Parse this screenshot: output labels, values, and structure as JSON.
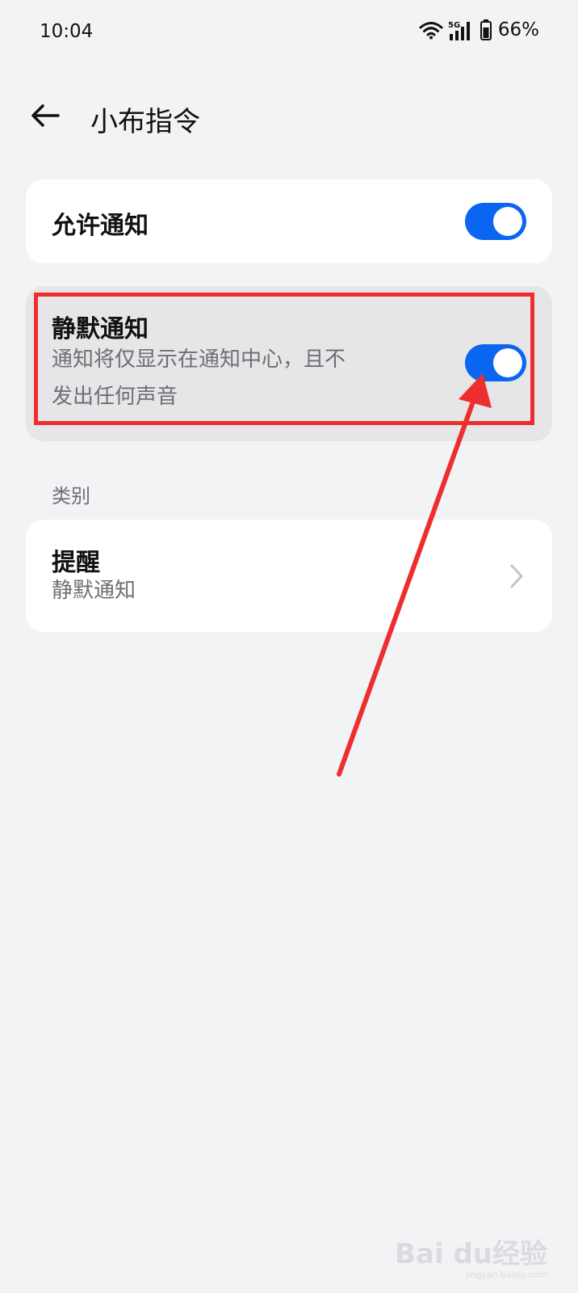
{
  "status": {
    "time": "10:04",
    "network": "5G",
    "battery": "66%"
  },
  "header": {
    "title": "小布指令"
  },
  "allow_notification": {
    "label": "允许通知",
    "enabled": true
  },
  "silent_notification": {
    "label": "静默通知",
    "desc_line1": "通知将仅显示在通知中心，且不",
    "desc_line2": "发出任何声音",
    "enabled": true
  },
  "category": {
    "section_label": "类别",
    "items": [
      {
        "title": "提醒",
        "subtitle": "静默通知"
      }
    ]
  },
  "watermark": {
    "logo": "Bai du经验",
    "domain": "jingyan.baidu.com"
  },
  "colors": {
    "accent": "#0a66f0",
    "annotation": "#ee2e2e",
    "background": "#f2f3f5"
  }
}
